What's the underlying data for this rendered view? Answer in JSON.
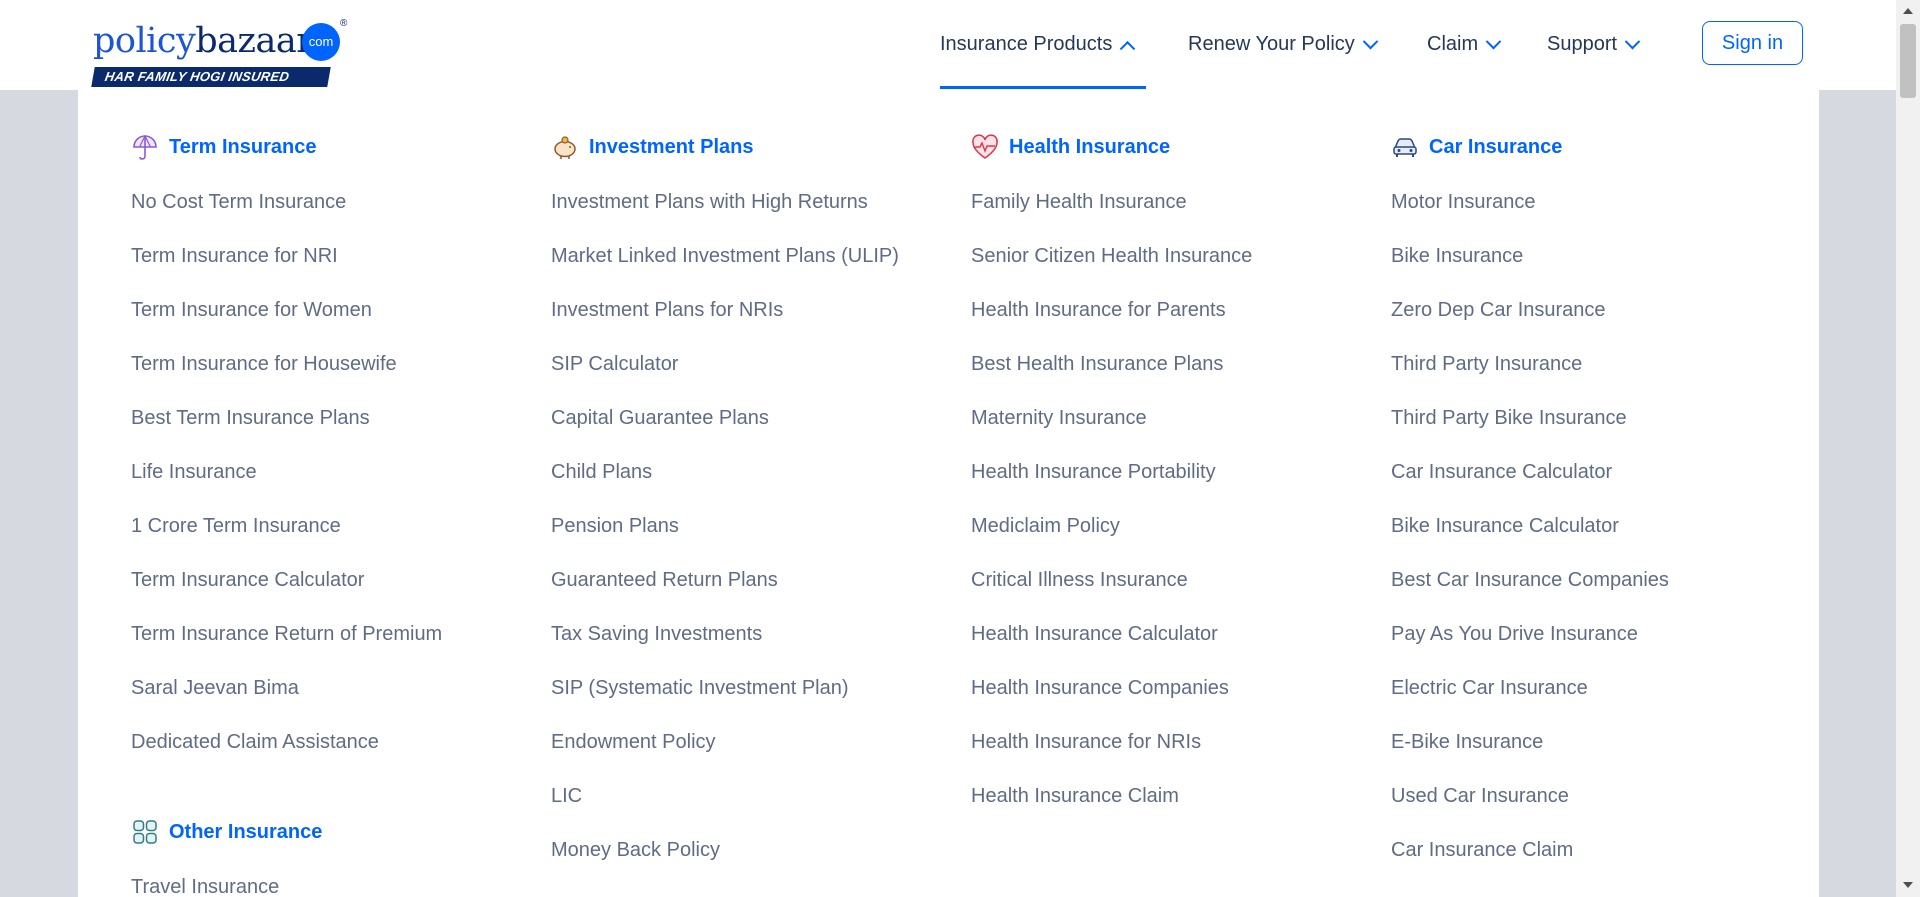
{
  "brand": {
    "policy": "policy",
    "bazaar": "bazaar",
    "com": "com",
    "reg": "®",
    "tagline": "HAR FAMILY HOGI INSURED"
  },
  "nav": {
    "items": [
      {
        "label": "Insurance Products",
        "state": "open"
      },
      {
        "label": "Renew Your Policy",
        "state": "closed"
      },
      {
        "label": "Claim",
        "state": "closed"
      },
      {
        "label": "Support",
        "state": "closed"
      }
    ],
    "signin": "Sign in"
  },
  "menu": {
    "columns": [
      {
        "title": "Term Insurance",
        "icon": "umbrella-icon",
        "links": [
          "No Cost Term Insurance",
          "Term Insurance for NRI",
          "Term Insurance for Women",
          "Term Insurance for Housewife",
          "Best Term Insurance Plans",
          "Life Insurance",
          "1 Crore Term Insurance",
          "Term Insurance Calculator",
          "Term Insurance Return of Premium",
          "Saral Jeevan Bima",
          "Dedicated Claim Assistance"
        ],
        "subsection": {
          "title": "Other Insurance",
          "icon": "grid-icon",
          "links": [
            "Travel Insurance"
          ]
        }
      },
      {
        "title": "Investment Plans",
        "icon": "piggy-bank-icon",
        "links": [
          "Investment Plans with High Returns",
          "Market Linked Investment Plans (ULIP)",
          "Investment Plans for NRIs",
          "SIP Calculator",
          "Capital Guarantee Plans",
          "Child Plans",
          "Pension Plans",
          "Guaranteed Return Plans",
          "Tax Saving Investments",
          "SIP (Systematic Investment Plan)",
          "Endowment Policy",
          "LIC",
          "Money Back Policy"
        ]
      },
      {
        "title": "Health Insurance",
        "icon": "heart-pulse-icon",
        "links": [
          "Family Health Insurance",
          "Senior Citizen Health Insurance",
          "Health Insurance for Parents",
          "Best Health Insurance Plans",
          "Maternity Insurance",
          "Health Insurance Portability",
          "Mediclaim Policy",
          "Critical Illness Insurance",
          "Health Insurance Calculator",
          "Health Insurance Companies",
          "Health Insurance for NRIs",
          "Health Insurance Claim"
        ]
      },
      {
        "title": "Car Insurance",
        "icon": "car-icon",
        "links": [
          "Motor Insurance",
          "Bike Insurance",
          "Zero Dep Car Insurance",
          "Third Party Insurance",
          "Third Party Bike Insurance",
          "Car Insurance Calculator",
          "Bike Insurance Calculator",
          "Best Car Insurance Companies",
          "Pay As You Drive Insurance",
          "Electric Car Insurance",
          "E-Bike Insurance",
          "Used Car Insurance",
          "Car Insurance Claim"
        ]
      }
    ]
  },
  "colors": {
    "accent": "#0065ff",
    "link": "#5e6c84",
    "nav_text": "#253858",
    "brand_dark": "#0a2a6b",
    "backdrop": "#d6d9df"
  }
}
